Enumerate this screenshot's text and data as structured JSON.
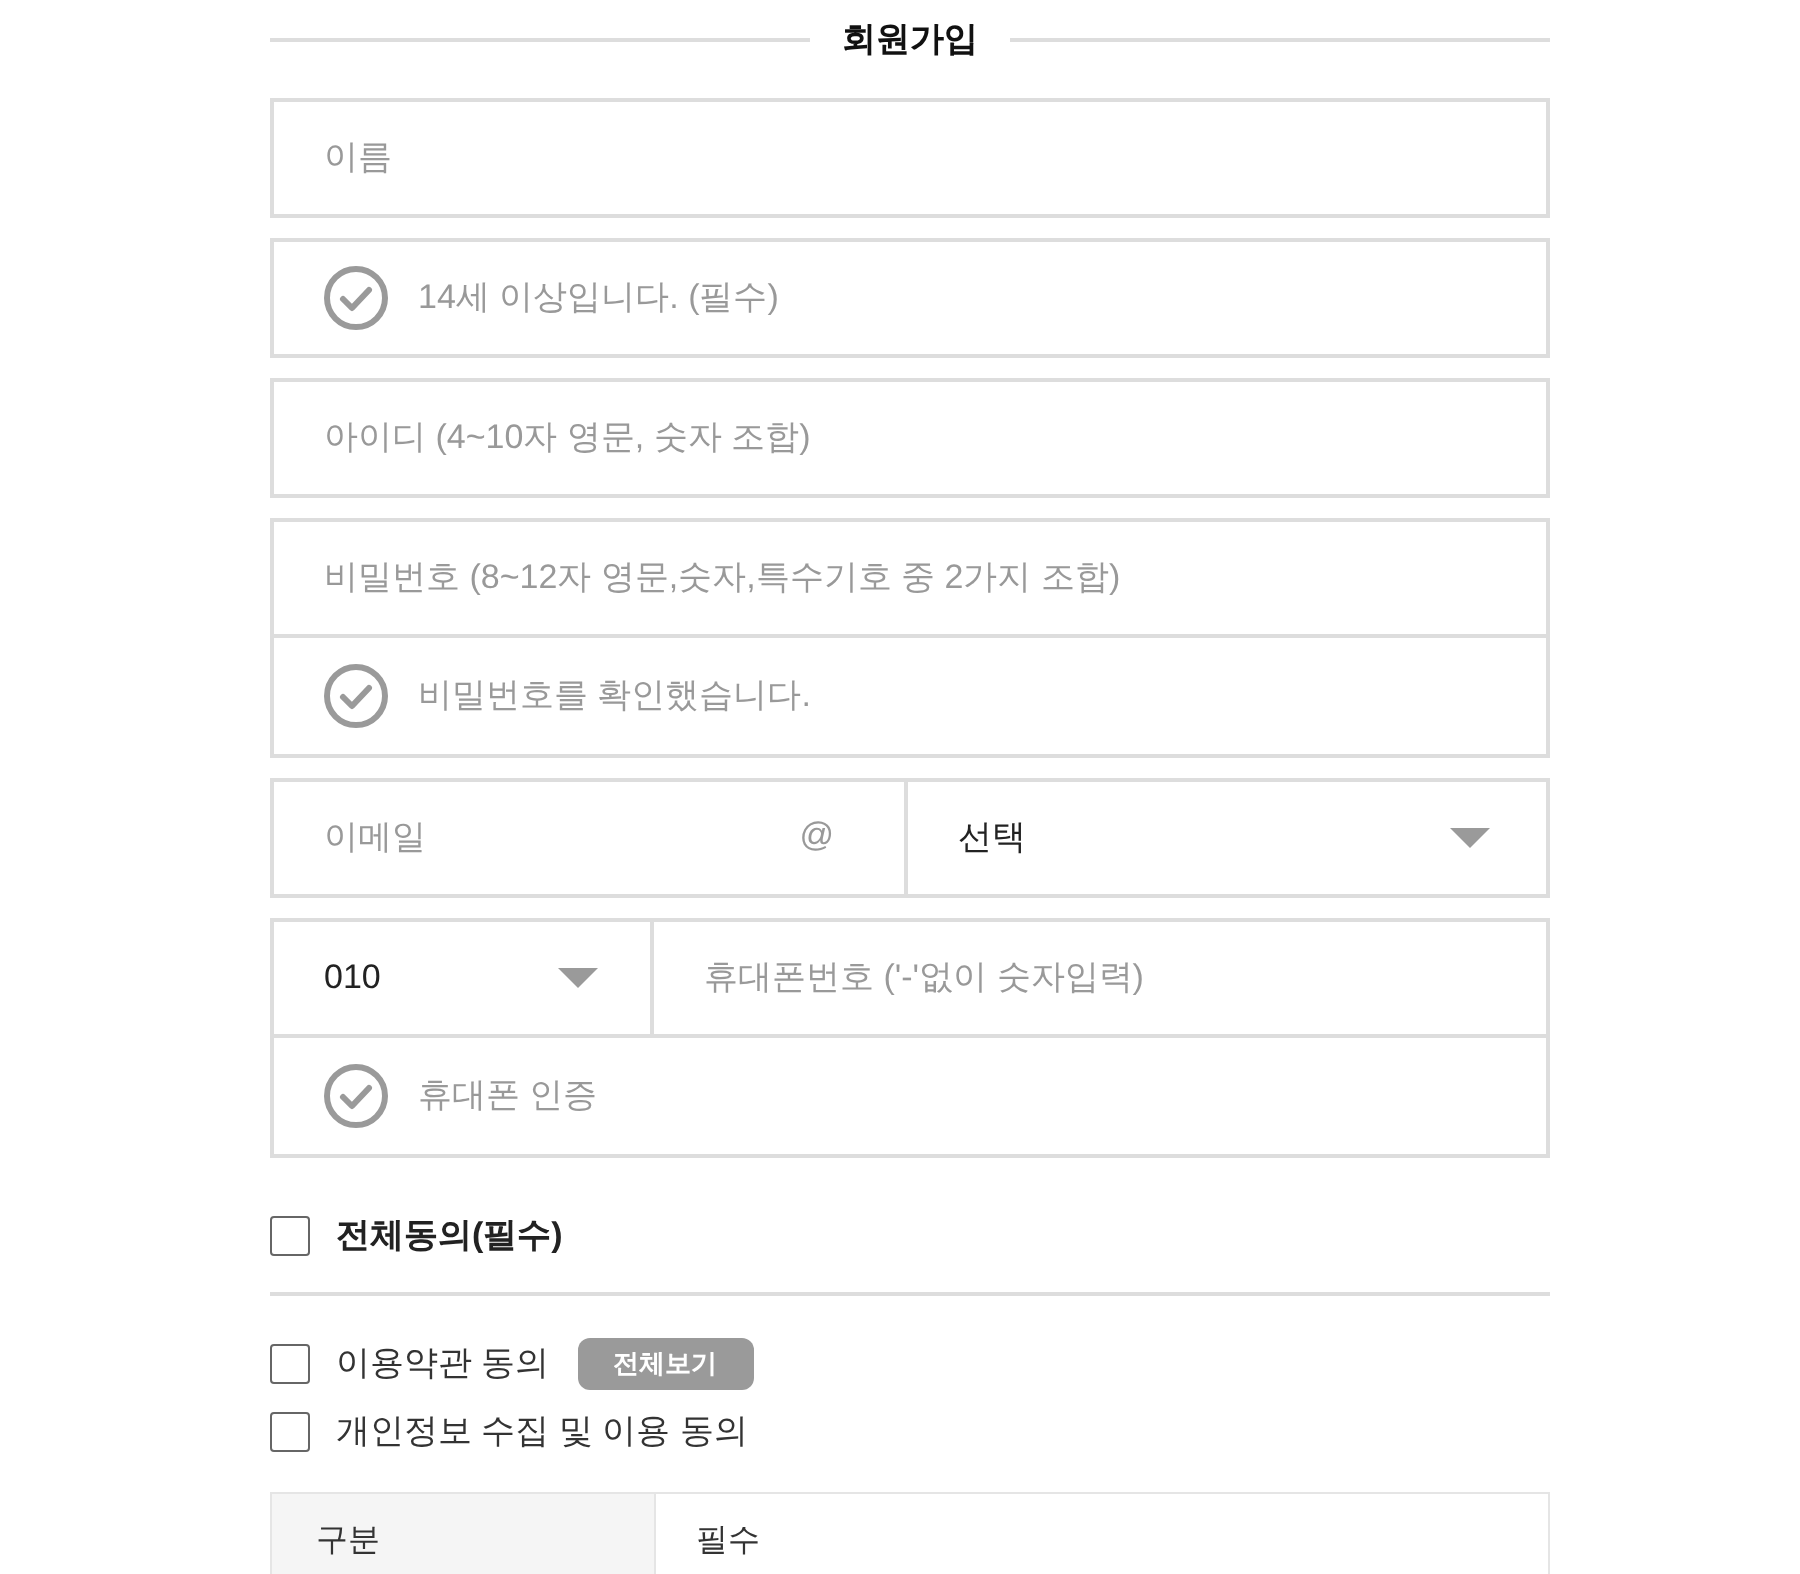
{
  "title": "회원가입",
  "form": [
    {
      "rows": [
        {
          "kind": "input",
          "placeholder": "이름"
        }
      ]
    },
    {
      "rows": [
        {
          "kind": "check",
          "label": "14세 이상입니다. (필수)",
          "checked": false
        }
      ]
    },
    {
      "rows": [
        {
          "kind": "input",
          "placeholder": "아이디 (4~10자 영문, 숫자 조합)"
        }
      ]
    },
    {
      "rows": [
        {
          "kind": "input",
          "placeholder": "비밀번호 (8~12자 영문,숫자,특수기호 중 2가지 조합)"
        },
        {
          "kind": "check",
          "label": "비밀번호를 확인했습니다.",
          "checked": false
        }
      ]
    },
    {
      "rows": [
        {
          "kind": "email",
          "placeholder": "이메일",
          "separator": "@",
          "domain": "선택"
        }
      ]
    },
    {
      "rows": [
        {
          "kind": "phone",
          "carrier": "010",
          "placeholder": "휴대폰번호 ('-'없이 숫자입력)"
        },
        {
          "kind": "check",
          "label": "휴대폰 인증",
          "checked": false
        }
      ]
    }
  ],
  "agree_all": {
    "label": "전체동의(필수)",
    "checked": false
  },
  "agreements": [
    {
      "label": "이용약관 동의",
      "checked": false,
      "button": "전체보기"
    },
    {
      "label": "개인정보 수집 및 이용 동의",
      "checked": false
    }
  ],
  "table": {
    "rows": [
      {
        "cells": [
          "구분",
          "필수"
        ]
      }
    ]
  }
}
